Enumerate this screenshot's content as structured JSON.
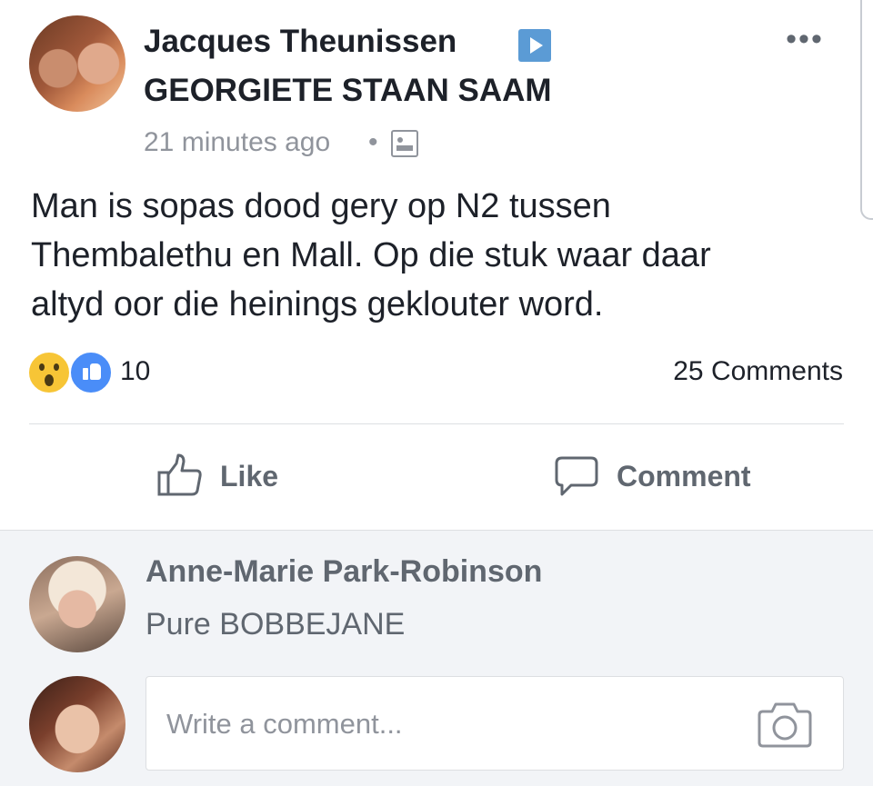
{
  "post": {
    "author": "Jacques Theunissen",
    "group": "GEORGIETE STAAN SAAM",
    "timestamp": "21 minutes ago",
    "separator": "•",
    "text_lines": [
      "Man is sopas dood gery op N2 tussen",
      "Thembalethu en Mall. Op die stuk waar daar",
      "altyd oor die heinings geklouter word."
    ],
    "reaction_count": "10",
    "comment_count": "25 Comments",
    "reactions": [
      "wow",
      "like"
    ],
    "more_icon": "•••"
  },
  "actions": {
    "like_label": "Like",
    "comment_label": "Comment"
  },
  "comment": {
    "author": "Anne-Marie Park-Robinson",
    "text": "Pure BOBBEJANE"
  },
  "composer": {
    "placeholder": "Write a comment..."
  },
  "colors": {
    "text": "#1d2129",
    "secondary": "#606770",
    "muted": "#90949c",
    "like_blue": "#4a8df8",
    "wow_yellow": "#f7c536",
    "comments_bg": "#f2f4f7"
  }
}
